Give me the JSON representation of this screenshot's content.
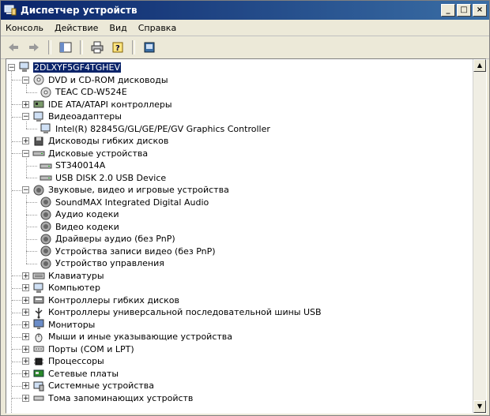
{
  "window": {
    "title": "Диспетчер устройств"
  },
  "menubar": {
    "items": [
      "Консоль",
      "Действие",
      "Вид",
      "Справка"
    ]
  },
  "tree": {
    "root": "2DLXYF5GF4TGHEV",
    "items": [
      {
        "label": "DVD и CD-ROM дисководы",
        "level": 1,
        "expander": "−",
        "icon": "cdrom-icon"
      },
      {
        "label": "TEAC CD-W524E",
        "level": 2,
        "expander": "",
        "icon": "cdrom-icon"
      },
      {
        "label": "IDE ATA/ATAPI контроллеры",
        "level": 1,
        "expander": "+",
        "icon": "ide-controller-icon"
      },
      {
        "label": "Видеоадаптеры",
        "level": 1,
        "expander": "−",
        "icon": "display-adapter-icon"
      },
      {
        "label": "Intel(R) 82845G/GL/GE/PE/GV Graphics Controller",
        "level": 2,
        "expander": "",
        "icon": "display-adapter-icon"
      },
      {
        "label": "Дисководы гибких дисков",
        "level": 1,
        "expander": "+",
        "icon": "floppy-drive-icon"
      },
      {
        "label": "Дисковые устройства",
        "level": 1,
        "expander": "−",
        "icon": "disk-drive-icon"
      },
      {
        "label": "ST340014A",
        "level": 2,
        "expander": "",
        "icon": "disk-drive-icon"
      },
      {
        "label": "USB DISK 2.0 USB Device",
        "level": 2,
        "expander": "",
        "icon": "disk-drive-icon"
      },
      {
        "label": "Звуковые, видео и игровые устройства",
        "level": 1,
        "expander": "−",
        "icon": "sound-icon"
      },
      {
        "label": "SoundMAX Integrated Digital Audio",
        "level": 2,
        "expander": "",
        "icon": "sound-icon"
      },
      {
        "label": "Аудио кодеки",
        "level": 2,
        "expander": "",
        "icon": "sound-icon"
      },
      {
        "label": "Видео кодеки",
        "level": 2,
        "expander": "",
        "icon": "sound-icon"
      },
      {
        "label": "Драйверы аудио (без PnP)",
        "level": 2,
        "expander": "",
        "icon": "sound-icon"
      },
      {
        "label": "Устройства записи видео (без PnP)",
        "level": 2,
        "expander": "",
        "icon": "sound-icon"
      },
      {
        "label": "Устройство управления",
        "level": 2,
        "expander": "",
        "icon": "sound-icon"
      },
      {
        "label": "Клавиатуры",
        "level": 1,
        "expander": "+",
        "icon": "keyboard-icon"
      },
      {
        "label": "Компьютер",
        "level": 1,
        "expander": "+",
        "icon": "computer-icon"
      },
      {
        "label": "Контроллеры гибких дисков",
        "level": 1,
        "expander": "+",
        "icon": "floppy-controller-icon"
      },
      {
        "label": "Контроллеры универсальной последовательной шины USB",
        "level": 1,
        "expander": "+",
        "icon": "usb-icon"
      },
      {
        "label": "Мониторы",
        "level": 1,
        "expander": "+",
        "icon": "monitor-icon"
      },
      {
        "label": "Мыши и иные указывающие устройства",
        "level": 1,
        "expander": "+",
        "icon": "mouse-icon"
      },
      {
        "label": "Порты (COM и LPT)",
        "level": 1,
        "expander": "+",
        "icon": "port-icon"
      },
      {
        "label": "Процессоры",
        "level": 1,
        "expander": "+",
        "icon": "processor-icon"
      },
      {
        "label": "Сетевые платы",
        "level": 1,
        "expander": "+",
        "icon": "network-card-icon"
      },
      {
        "label": "Системные устройства",
        "level": 1,
        "expander": "+",
        "icon": "system-device-icon"
      },
      {
        "label": "Тома запоминающих устройств",
        "level": 1,
        "expander": "+",
        "icon": "storage-volume-icon"
      }
    ]
  }
}
